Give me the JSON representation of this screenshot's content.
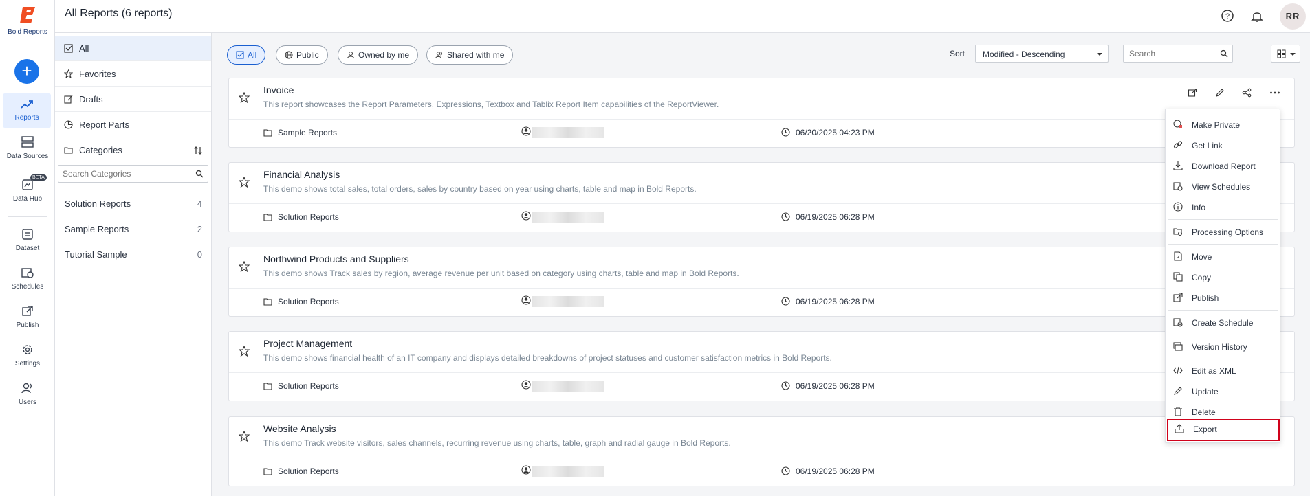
{
  "app": {
    "logo_text": "Bold Reports",
    "accent": "#1a73e8"
  },
  "rail": {
    "items": [
      {
        "label": "Reports",
        "icon": "trend-icon",
        "active": true
      },
      {
        "label": "Data Sources",
        "icon": "database-icon"
      },
      {
        "label": "Data Hub",
        "icon": "data-hub-icon",
        "badge": "BETA"
      },
      {
        "label": "Dataset",
        "icon": "dataset-icon"
      },
      {
        "label": "Schedules",
        "icon": "schedule-icon"
      },
      {
        "label": "Publish",
        "icon": "publish-icon"
      },
      {
        "label": "Settings",
        "icon": "gear-icon"
      },
      {
        "label": "Users",
        "icon": "users-icon"
      }
    ]
  },
  "header": {
    "title": "All Reports (6 reports)",
    "avatar": "RR"
  },
  "sidebar": {
    "items": [
      {
        "label": "All"
      },
      {
        "label": "Favorites"
      },
      {
        "label": "Drafts"
      },
      {
        "label": "Report Parts"
      },
      {
        "label": "Categories"
      }
    ],
    "category_search_placeholder": "Search Categories",
    "categories": [
      {
        "name": "Solution Reports",
        "count": "4"
      },
      {
        "name": "Sample Reports",
        "count": "2"
      },
      {
        "name": "Tutorial Sample",
        "count": "0"
      }
    ]
  },
  "filters": {
    "all": "All",
    "public": "Public",
    "owned": "Owned by me",
    "shared": "Shared with me"
  },
  "sort": {
    "label": "Sort",
    "value": "Modified - Descending"
  },
  "search": {
    "placeholder": "Search"
  },
  "reports": [
    {
      "title": "Invoice",
      "desc": "This report showcases the Report Parameters, Expressions, Textbox and Tablix Report Item capabilities of the ReportViewer.",
      "category": "Sample Reports",
      "date": "06/20/2025 04:23 PM"
    },
    {
      "title": "Financial Analysis",
      "desc": "This demo shows total sales, total orders, sales by country based on year using charts, table and map in Bold Reports.",
      "category": "Solution Reports",
      "date": "06/19/2025 06:28 PM"
    },
    {
      "title": "Northwind Products and Suppliers",
      "desc": "This demo shows Track sales by region, average revenue per unit based on category using charts, table and map in Bold Reports.",
      "category": "Solution Reports",
      "date": "06/19/2025 06:28 PM"
    },
    {
      "title": "Project Management",
      "desc": "This demo shows financial health of an IT company and displays detailed breakdowns of project statuses and customer satisfaction metrics in Bold Reports.",
      "category": "Solution Reports",
      "date": "06/19/2025 06:28 PM"
    },
    {
      "title": "Website Analysis",
      "desc": "This demo Track website visitors, sales channels, recurring revenue using charts, table, graph and radial gauge in Bold Reports.",
      "category": "Solution Reports",
      "date": "06/19/2025 06:28 PM"
    }
  ],
  "menu": {
    "items": [
      {
        "label": "Make Private",
        "icon": "make-private-icon"
      },
      {
        "label": "Get Link",
        "icon": "link-icon"
      },
      {
        "label": "Download Report",
        "icon": "download-icon"
      },
      {
        "label": "View Schedules",
        "icon": "view-schedules-icon"
      },
      {
        "label": "Info",
        "icon": "info-icon"
      },
      {
        "label": "Processing Options",
        "icon": "processing-icon"
      },
      {
        "label": "Move",
        "icon": "move-icon"
      },
      {
        "label": "Copy",
        "icon": "copy-icon"
      },
      {
        "label": "Publish",
        "icon": "publish-icon"
      },
      {
        "label": "Create Schedule",
        "icon": "create-schedule-icon"
      },
      {
        "label": "Version History",
        "icon": "version-history-icon"
      },
      {
        "label": "Edit as XML",
        "icon": "code-icon"
      },
      {
        "label": "Update",
        "icon": "pencil-icon"
      },
      {
        "label": "Delete",
        "icon": "trash-icon"
      },
      {
        "label": "Export",
        "icon": "export-icon",
        "highlight": "#d0021b"
      }
    ]
  }
}
